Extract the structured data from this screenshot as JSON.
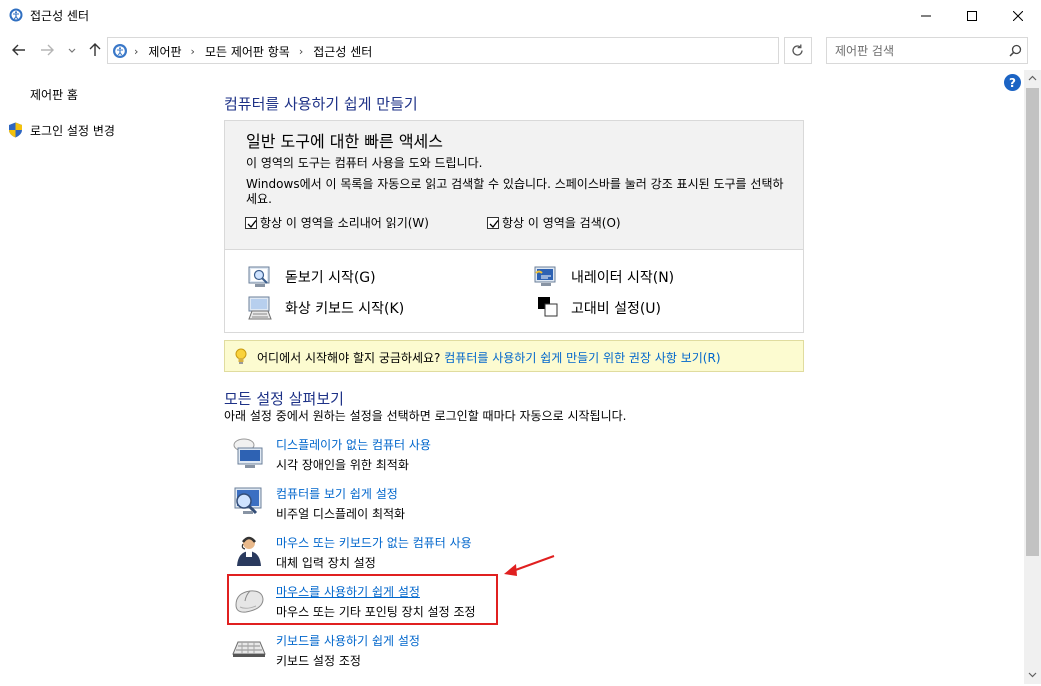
{
  "window": {
    "title": "접근성 센터"
  },
  "address": {
    "crumbs": [
      "제어판",
      "모든 제어판 항목",
      "접근성 센터"
    ],
    "search_placeholder": "제어판 검색"
  },
  "sidebar": {
    "home": "제어판 홈",
    "login": "로그인 설정 변경"
  },
  "help": "?",
  "main": {
    "title": "컴퓨터를 사용하기 쉽게 만들기",
    "quick": {
      "title": "일반 도구에 대한 빠른 액세스",
      "desc1": "이 영역의 도구는 컴퓨터 사용을 도와 드립니다.",
      "desc2": "Windows에서 이 목록을 자동으로 읽고 검색할 수 있습니다. 스페이스바를 눌러 강조 표시된 도구를 선택하세요.",
      "check_read": "항상 이 영역을 소리내어 읽기(W)",
      "check_scan": "항상 이 영역을 검색(O)",
      "tools": {
        "magnifier": "돋보기 시작(G)",
        "narrator": "내레이터 시작(N)",
        "osk": "화상 키보드 시작(K)",
        "contrast": "고대비 설정(U)"
      }
    },
    "tip": {
      "text": "어디에서 시작해야 할지 궁금하세요?",
      "link": "컴퓨터를 사용하기 쉽게 만들기 위한 권장 사항 보기(R)"
    },
    "explore": {
      "title": "모든 설정 살펴보기",
      "desc": "아래 설정 중에서 원하는 설정을 선택하면 로그인할 때마다 자동으로 시작됩니다.",
      "items": [
        {
          "title": "디스플레이가 없는 컴퓨터 사용",
          "desc": "시각 장애인을 위한 최적화"
        },
        {
          "title": "컴퓨터를 보기 쉽게 설정",
          "desc": "비주얼 디스플레이 최적화"
        },
        {
          "title": "마우스 또는 키보드가 없는 컴퓨터 사용",
          "desc": "대체 입력 장치 설정"
        },
        {
          "title": "마우스를 사용하기 쉽게 설정",
          "desc": "마우스 또는 기타 포인팅 장치 설정 조정"
        },
        {
          "title": "키보드를 사용하기 쉽게 설정",
          "desc": "키보드 설정 조정"
        }
      ]
    }
  },
  "colors": {
    "heading": "#1e3287",
    "link": "#0066cc",
    "highlight": "#e02020",
    "tip_bg": "#fcfbd0"
  }
}
